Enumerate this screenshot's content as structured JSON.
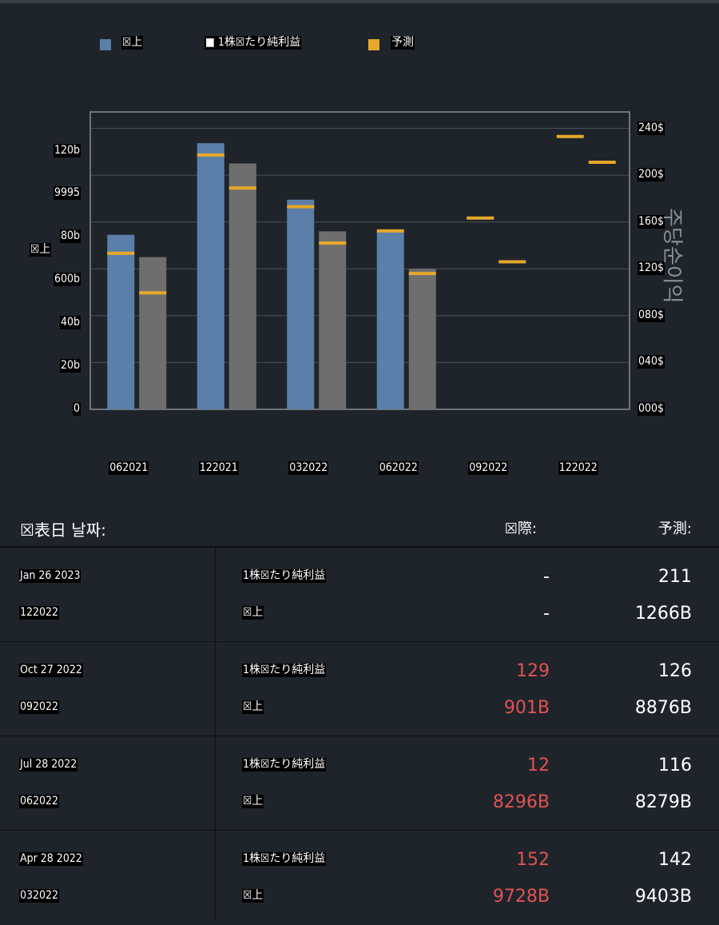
{
  "legend": [
    {
      "label": "☒上",
      "color": "#5b7fa8"
    },
    {
      "label": "■ 1株☒たり純利益",
      "color": "#6e6e6e"
    },
    {
      "label": "予測",
      "color": "#e6a82a"
    }
  ],
  "chart_data": {
    "type": "bar",
    "categories": [
      "062021",
      "122021",
      "032022",
      "062022",
      "092022",
      "122022"
    ],
    "left_axis": {
      "title": "☒上",
      "ticks": [
        "0",
        "20b",
        "40b",
        "600b",
        "80b",
        "9995",
        "120b"
      ],
      "tick_values": [
        0,
        20,
        40,
        60,
        80,
        100,
        120
      ],
      "range": [
        0,
        138
      ]
    },
    "right_axis": {
      "title": "주당순이익",
      "ticks": [
        "000$",
        "040$",
        "080$",
        "120$",
        "160$",
        "200$",
        "240$"
      ],
      "tick_values": [
        0,
        40,
        80,
        120,
        160,
        200,
        240
      ],
      "range": [
        0,
        254
      ]
    },
    "series": [
      {
        "name": "☒上",
        "axis": "left",
        "values": [
          81,
          123.5,
          97.28,
          82.96,
          null,
          null
        ],
        "color": "#5b7fa8"
      },
      {
        "name": "1株☒たり純利益",
        "axis": "right",
        "values": [
          130,
          210,
          152,
          120,
          null,
          null
        ],
        "color": "#6e6e6e"
      },
      {
        "name": "予測 (☒上)",
        "axis": "left",
        "values": [
          72.4,
          118,
          94.03,
          82.79,
          88.76,
          126.6
        ],
        "color": "#e6a82a"
      },
      {
        "name": "予測 (1株☒たり純利益)",
        "axis": "right",
        "values": [
          99.5,
          189,
          142,
          116,
          126,
          211
        ],
        "color": "#e6a82a"
      }
    ],
    "grid": true
  },
  "table": {
    "headers": {
      "date": "☒表日 날짜:",
      "actual": "☒際:",
      "forecast": "予測:"
    },
    "rows": [
      {
        "date": "Jan 26 2023",
        "period": "122022",
        "eps_label": "1株☒たり純利益",
        "rev_label": "☒上",
        "eps_actual": "-",
        "eps_forecast": "211",
        "rev_actual": "-",
        "rev_forecast": "1266B"
      },
      {
        "date": "Oct 27 2022",
        "period": "092022",
        "eps_label": "1株☒たり純利益",
        "rev_label": "☒上",
        "eps_actual": "129",
        "eps_forecast": "126",
        "rev_actual": "901B",
        "rev_forecast": "8876B"
      },
      {
        "date": "Jul 28 2022",
        "period": "062022",
        "eps_label": "1株☒たり純利益",
        "rev_label": "☒上",
        "eps_actual": "12",
        "eps_forecast": "116",
        "rev_actual": "8296B",
        "rev_forecast": "8279B"
      },
      {
        "date": "Apr 28 2022",
        "period": "032022",
        "eps_label": "1株☒たり純利益",
        "rev_label": "☒上",
        "eps_actual": "152",
        "eps_forecast": "142",
        "rev_actual": "9728B",
        "rev_forecast": "9403B"
      }
    ],
    "colors": {
      "miss": "#e05252",
      "neutral": "#ffffff"
    }
  }
}
